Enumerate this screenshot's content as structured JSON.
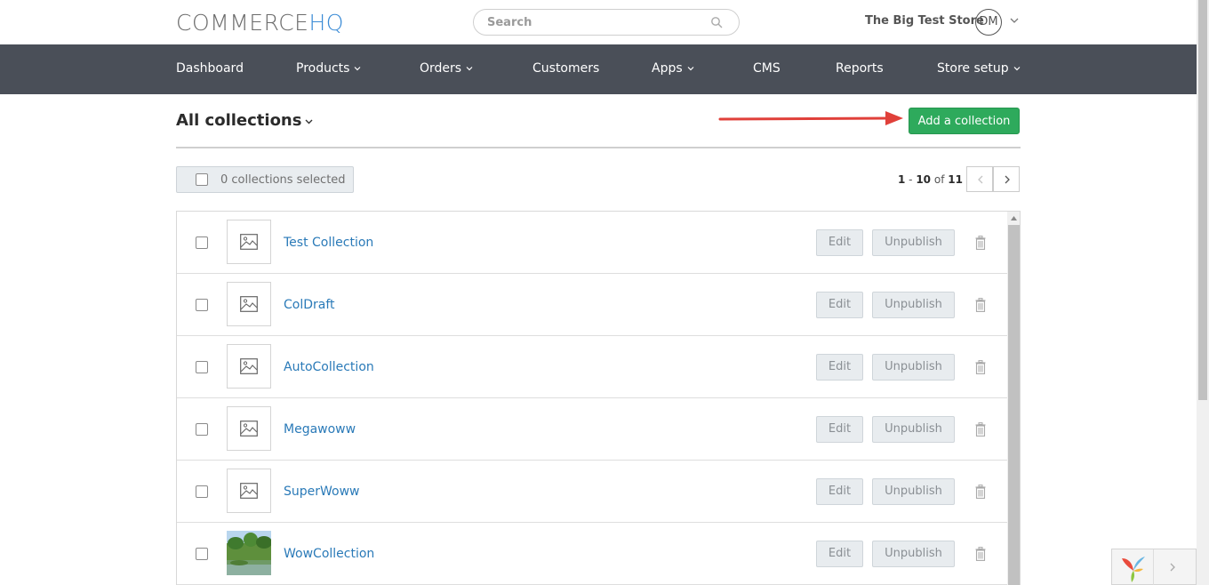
{
  "header": {
    "logo_part1": "COMMERCE",
    "logo_part2": "HQ",
    "search_placeholder": "Search",
    "store_name": "The Big Test Store",
    "avatar_initials": "DM"
  },
  "nav": {
    "items": [
      {
        "label": "Dashboard",
        "has_caret": false
      },
      {
        "label": "Products",
        "has_caret": true
      },
      {
        "label": "Orders",
        "has_caret": true
      },
      {
        "label": "Customers",
        "has_caret": false
      },
      {
        "label": "Apps",
        "has_caret": true
      },
      {
        "label": "CMS",
        "has_caret": false
      },
      {
        "label": "Reports",
        "has_caret": false
      },
      {
        "label": "Store setup",
        "has_caret": true
      }
    ]
  },
  "page": {
    "title": "All collections",
    "add_button": "Add a collection",
    "selected_label": "0 collections selected",
    "pager": {
      "from": "1",
      "to": "10",
      "of_word": "of",
      "total": "11"
    }
  },
  "collections": [
    {
      "name": "Test Collection",
      "thumb": "placeholder-image-icon",
      "edit": "Edit",
      "unpublish": "Unpublish"
    },
    {
      "name": "ColDraft",
      "thumb": "placeholder-image-icon",
      "edit": "Edit",
      "unpublish": "Unpublish"
    },
    {
      "name": "AutoCollection",
      "thumb": "placeholder-image-icon",
      "edit": "Edit",
      "unpublish": "Unpublish"
    },
    {
      "name": "Megawoww",
      "thumb": "placeholder-image-icon",
      "edit": "Edit",
      "unpublish": "Unpublish"
    },
    {
      "name": "SuperWoww",
      "thumb": "placeholder-image-icon",
      "edit": "Edit",
      "unpublish": "Unpublish"
    },
    {
      "name": "WowCollection",
      "thumb": "photo-thumbnail",
      "edit": "Edit",
      "unpublish": "Unpublish"
    }
  ],
  "colors": {
    "nav_bg": "#4a4f58",
    "accent_green": "#2eaa5c",
    "link_blue": "#2a7ab8",
    "logo_blue": "#3a8bd6",
    "annotation_red": "#e0403a"
  }
}
